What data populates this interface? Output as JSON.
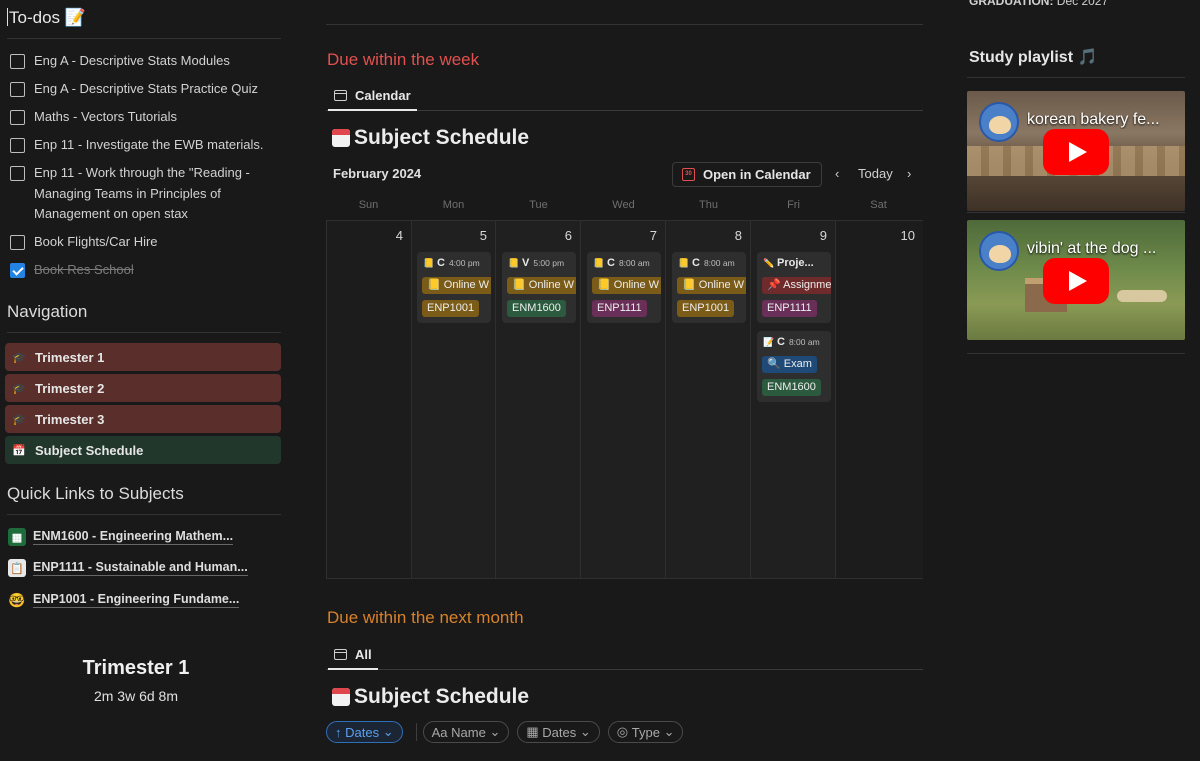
{
  "todos": {
    "title": "To-dos 📝",
    "items": [
      {
        "label": "Eng A - Descriptive Stats Modules",
        "checked": false
      },
      {
        "label": "Eng A - Descriptive Stats Practice Quiz",
        "checked": false
      },
      {
        "label": "Maths - Vectors Tutorials",
        "checked": false
      },
      {
        "label": "Enp 11 - Investigate the EWB materials.",
        "checked": false
      },
      {
        "label": "Enp 11 - Work through the \"Reading - Managing Teams in Principles of Management on open stax",
        "checked": false
      },
      {
        "label": "Book Flights/Car Hire",
        "checked": false
      },
      {
        "label": "Book Res School",
        "checked": true
      }
    ]
  },
  "navigation": {
    "title": "Navigation",
    "items": [
      {
        "label": "Trimester 1",
        "icon": "graduation-cap-icon",
        "color": "#5a2e2b"
      },
      {
        "label": "Trimester 2",
        "icon": "graduation-cap-icon",
        "color": "#5a2e2b"
      },
      {
        "label": "Trimester 3",
        "icon": "graduation-cap-icon",
        "color": "#5a2e2b"
      },
      {
        "label": "Subject Schedule",
        "icon": "calendar-icon",
        "color": "#22372c"
      }
    ]
  },
  "quick_links": {
    "title": "Quick Links to Subjects",
    "items": [
      {
        "label": "ENM1600 - Engineering Mathem...",
        "icon": "spreadsheet-icon"
      },
      {
        "label": "ENP1111 - Sustainable and Human...",
        "icon": "clipboard-icon"
      },
      {
        "label": "ENP1001 - Engineering Fundame...",
        "icon": "nerd-face-icon"
      }
    ]
  },
  "countdown": {
    "title": "Trimester 1",
    "value": "2m 3w 6d 8m"
  },
  "week_section": {
    "heading": "Due within the week",
    "heading_color": "#e0514f",
    "tab": "Calendar",
    "db_title": "Subject Schedule",
    "month": "February 2024",
    "open_calendar": "Open in Calendar",
    "today": "Today",
    "prev": "‹",
    "next": "›",
    "day_headers": [
      "Sun",
      "Mon",
      "Tue",
      "Wed",
      "Thu",
      "Fri",
      "Sat"
    ],
    "dates": [
      "4",
      "5",
      "6",
      "7",
      "8",
      "9",
      "10"
    ],
    "cards": [
      {
        "day": 1,
        "title": "C",
        "time": "4:00 pm",
        "type": "Online W",
        "subject": "ENP1001",
        "subject_color": "yellow"
      },
      {
        "day": 2,
        "title": "V",
        "time": "5:00 pm",
        "type": "Online W",
        "subject": "ENM1600",
        "subject_color": "green"
      },
      {
        "day": 3,
        "title": "C",
        "time": "8:00 am",
        "type": "Online W",
        "subject": "ENP1111",
        "subject_color": "purple"
      },
      {
        "day": 4,
        "title": "C",
        "time": "8:00 am",
        "type": "Online W",
        "subject": "ENP1001",
        "subject_color": "yellow"
      },
      {
        "day": 5,
        "title": "Proje...",
        "time": "",
        "type": "Assignme",
        "subject": "ENP1111",
        "subject_color": "purple"
      },
      {
        "day": 5,
        "title": "C",
        "time": "8:00 am",
        "type": "Exam",
        "subject": "ENM1600",
        "subject_color": "green"
      }
    ]
  },
  "month_section": {
    "heading": "Due within the next month",
    "heading_color": "#d9822b",
    "tab": "All",
    "db_title": "Subject Schedule",
    "filters": [
      {
        "label": "Dates",
        "prefix": "↑",
        "active": true
      },
      {
        "label": "Name",
        "prefix": "Aa",
        "active": false
      },
      {
        "label": "Dates",
        "prefix": "▦",
        "active": false
      },
      {
        "label": "Type",
        "prefix": "◎",
        "active": false
      }
    ]
  },
  "right": {
    "graduation_label": "GRADUATION:",
    "graduation_value": "Dec 2027",
    "playlist_title": "Study playlist 🎵",
    "videos": [
      {
        "title": "korean bakery fe..."
      },
      {
        "title": "vibin' at the dog ..."
      }
    ]
  }
}
